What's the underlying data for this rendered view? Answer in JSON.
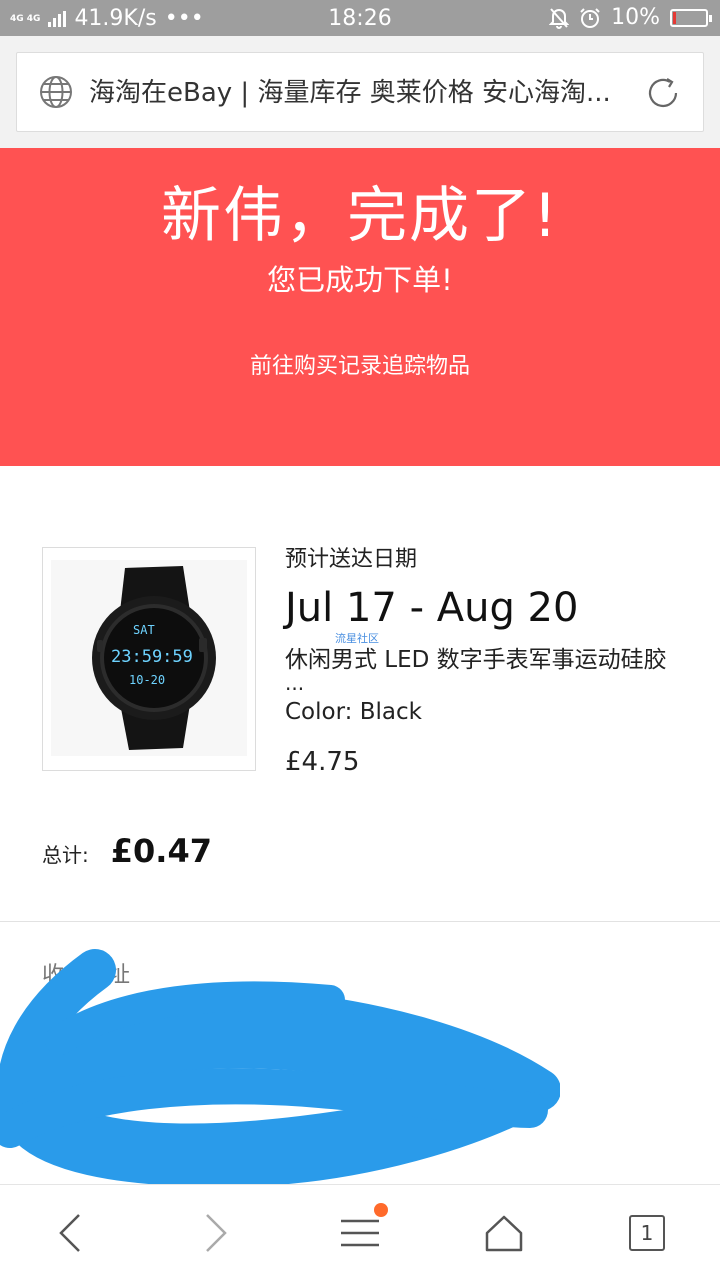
{
  "status_bar": {
    "network": "4G 4G",
    "speed": "41.9K/s",
    "more": "•••",
    "time": "18:26",
    "battery": "10%",
    "battery_level": 0.1,
    "battery_color": "#e53935"
  },
  "url_bar": {
    "title": "海淘在eBay | 海量库存 奥莱价格 安心海淘...",
    "icon": "globe-icon",
    "reload_icon": "reload-icon"
  },
  "hero": {
    "title": "新伟，完成了!",
    "subtitle": "您已成功下单!",
    "link": "前往购买记录追踪物品",
    "bg_color": "#ff5252"
  },
  "order": {
    "eta_label": "预计送达日期",
    "eta_range": "Jul 17 - Aug 20",
    "watermark": "流星社区",
    "item_title": "休闲男式 LED 数字手表军事运动硅胶",
    "item_title_more": "...",
    "item_color": "Color: Black",
    "item_price": "£4.75",
    "watch_display": {
      "day": "SAT",
      "time": "23:59:59",
      "date": "10-20"
    }
  },
  "total": {
    "label": "总计:",
    "value": "£0.47"
  },
  "address": {
    "label": "收货地址"
  },
  "bottom_nav": {
    "back": "back-icon",
    "forward": "forward-icon",
    "menu": "menu-icon",
    "home": "home-icon",
    "tabs_count": "1"
  }
}
